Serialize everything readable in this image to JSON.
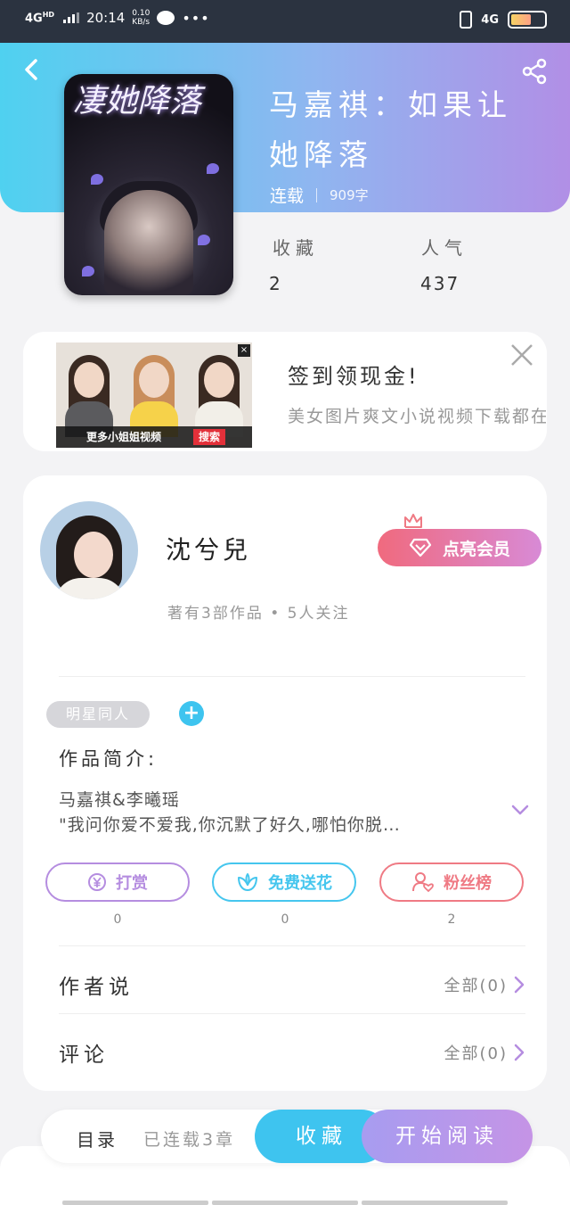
{
  "status_bar": {
    "network": "4G",
    "network_sup": "HD",
    "time": "20:14",
    "speed_value": "0.10",
    "speed_unit": "KB/s",
    "dots": "•••",
    "right_network": "4G"
  },
  "book": {
    "cover_title": "凄她降落",
    "title": "马嘉祺：如果让她降落",
    "status": "连载",
    "word_count": "909字",
    "stats": [
      {
        "label": "收藏",
        "value": "2"
      },
      {
        "label": "人气",
        "value": "437"
      }
    ]
  },
  "ad": {
    "bar_text": "更多小姐姐视频",
    "bar_button": "搜索",
    "small_close": "×",
    "title": "签到领现金!",
    "description": "美女图片爽文小说视频下载都在这里!"
  },
  "author": {
    "name": "沈兮兒",
    "stats": "著有3部作品 • 5人关注",
    "vip_label": "点亮会员",
    "tag": "明星同人",
    "tag_add": "+",
    "intro_label": "作品简介:",
    "intro_lines": [
      "马嘉祺&李曦瑶",
      "\"我问你爱不爱我,你沉默了好久,哪怕你脱…"
    ]
  },
  "actions": [
    {
      "label": "打赏",
      "icon": "yen-coin-icon",
      "count": "0"
    },
    {
      "label": "免费送花",
      "icon": "flower-icon",
      "count": "0"
    },
    {
      "label": "粉丝榜",
      "icon": "fan-user-icon",
      "count": "2"
    }
  ],
  "rows": [
    {
      "label": "作者说",
      "right": "全部(0)"
    },
    {
      "label": "评论",
      "right": "全部(0)"
    }
  ],
  "bottom_bar": {
    "catalog": "目录",
    "chapters": "已连载3章",
    "collect": "收藏",
    "read": "开始阅读"
  },
  "colors": {
    "cyan": "#3ec4ef",
    "purple": "#b58de0",
    "red": "#ef7a84",
    "header_start": "#4fd1f0",
    "header_end": "#b18fe6"
  }
}
